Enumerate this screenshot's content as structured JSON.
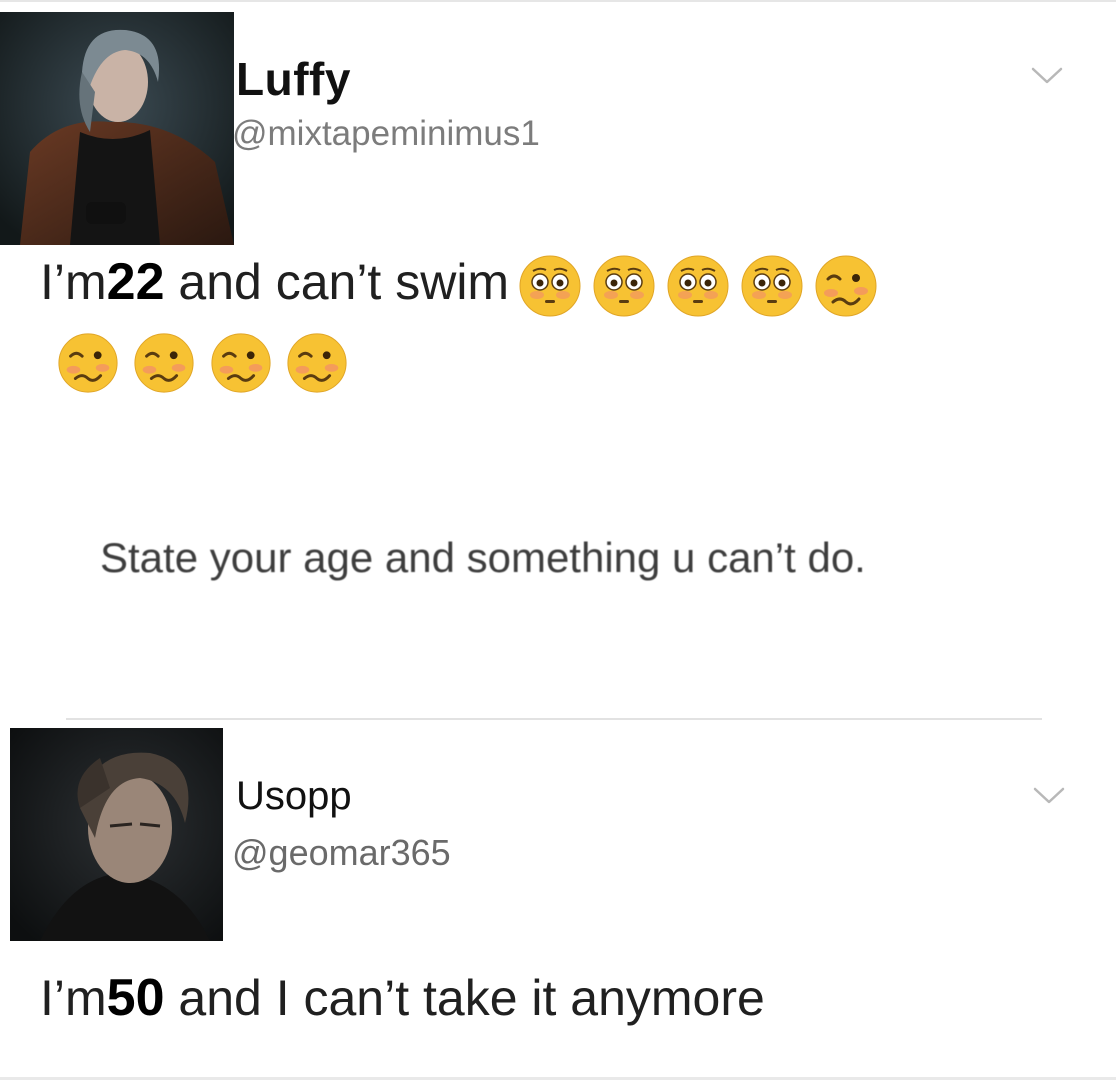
{
  "tweet1": {
    "display_name": "Luffy",
    "handle": "@mixtapeminimus1",
    "text_prefix": "I’m",
    "age": "22",
    "text_suffix": " and can’t swim",
    "emojis": [
      "flushed-face",
      "flushed-face",
      "flushed-face",
      "flushed-face",
      "woozy-face",
      "woozy-face",
      "woozy-face",
      "woozy-face",
      "woozy-face"
    ]
  },
  "quoted_prompt": "State your age and something u can’t do.",
  "tweet2": {
    "display_name": "Usopp",
    "handle": "@geomar365",
    "text_prefix": "I’m",
    "age": "50",
    "text_suffix": " and I can’t take it anymore"
  },
  "colors": {
    "handle_gray": "#7c7c7c",
    "emoji_yellow": "#f7c233",
    "chevron_gray": "#b8b8b8"
  }
}
